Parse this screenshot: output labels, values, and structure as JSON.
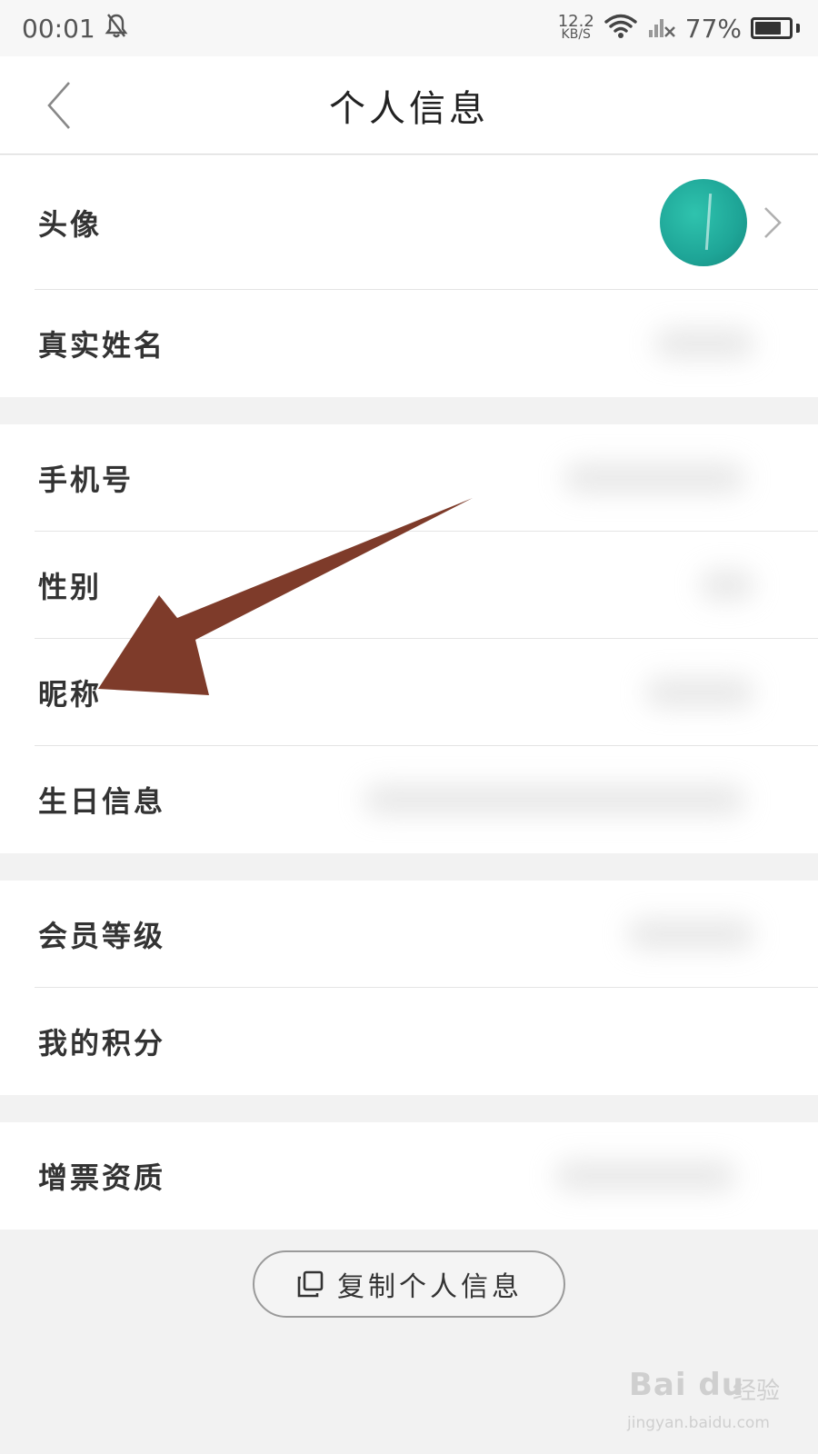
{
  "status_bar": {
    "time": "00:01",
    "net_speed_value": "12.2",
    "net_speed_unit": "KB/S",
    "battery_percent": "77%",
    "battery_level": 0.77
  },
  "header": {
    "title": "个人信息"
  },
  "rows": [
    {
      "label": "头像"
    },
    {
      "label": "真实姓名"
    },
    {
      "label": "手机号"
    },
    {
      "label": "性别"
    },
    {
      "label": "昵称"
    },
    {
      "label": "生日信息"
    },
    {
      "label": "会员等级"
    },
    {
      "label": "我的积分"
    },
    {
      "label": "增票资质"
    }
  ],
  "copy_button": {
    "label": "复制个人信息"
  },
  "watermark": {
    "brand": "Bai du",
    "cn": "经验",
    "url": "jingyan.baidu.com"
  },
  "colors": {
    "annotation_arrow": "#7e3b2a",
    "avatar": "#23b3a2"
  },
  "icons": [
    "bell-off-icon",
    "wifi-icon",
    "signal-icon",
    "battery-icon",
    "back-icon",
    "chevron-right-icon",
    "copy-icon"
  ]
}
